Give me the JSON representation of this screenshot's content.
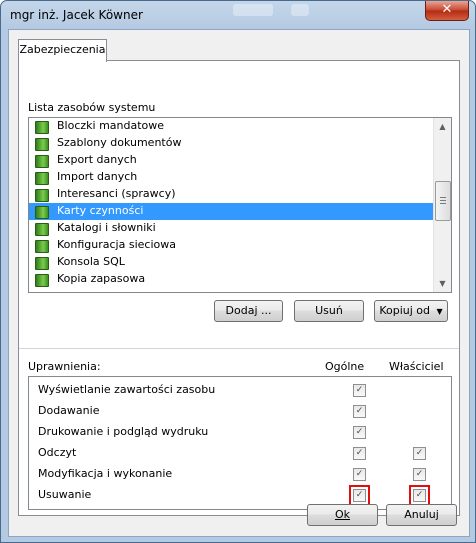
{
  "window": {
    "title": "mgr inż. Jacek Köwner",
    "close_glyph": "✕"
  },
  "tab": {
    "label": "Zabezpieczenia"
  },
  "resources": {
    "label": "Lista zasobów systemu",
    "items": [
      {
        "label": "Bloczki mandatowe"
      },
      {
        "label": "Szablony dokumentów"
      },
      {
        "label": "Export danych"
      },
      {
        "label": "Import danych"
      },
      {
        "label": "Interesanci (sprawcy)"
      },
      {
        "label": "Karty czynności",
        "selected": true
      },
      {
        "label": "Katalogi i słowniki"
      },
      {
        "label": "Konfiguracja sieciowa"
      },
      {
        "label": "Konsola SQL"
      },
      {
        "label": "Kopia zapasowa"
      }
    ],
    "scroll_up": "▲",
    "scroll_down": "▼"
  },
  "actions": {
    "add": "Dodaj ...",
    "remove": "Usuń",
    "copy_from": "Kopiuj od",
    "copy_arrow": "▼"
  },
  "permissions": {
    "label": "Uprawnienia:",
    "col_general": "Ogólne",
    "col_owner": "Właściciel",
    "check_glyph": "✓",
    "rows": [
      {
        "label": "Wyświetlanie zawartości zasobu",
        "general": true,
        "owner": null
      },
      {
        "label": "Dodawanie",
        "general": true,
        "owner": null
      },
      {
        "label": "Drukowanie i podgląd wydruku",
        "general": true,
        "owner": null
      },
      {
        "label": "Odczyt",
        "general": true,
        "owner": true
      },
      {
        "label": "Modyfikacja i wykonanie",
        "general": true,
        "owner": true
      },
      {
        "label": "Usuwanie",
        "general": true,
        "owner": true,
        "highlighted": true
      }
    ]
  },
  "footer": {
    "ok": "Ok",
    "cancel": "Anuluj"
  },
  "colors": {
    "selection": "#3399ff",
    "highlight_border": "#e01010"
  }
}
